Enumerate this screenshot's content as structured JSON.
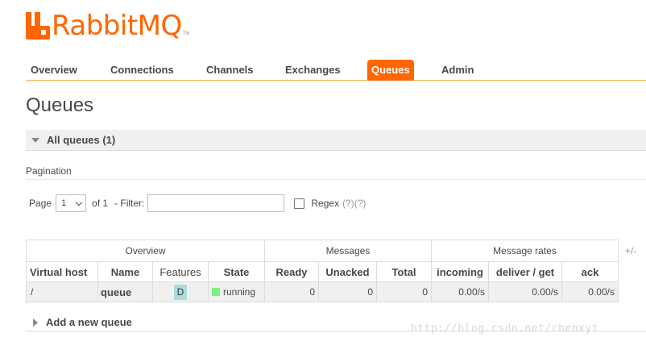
{
  "brand": {
    "name": "RabbitMQ",
    "tm": "TM",
    "color": "#ff6600"
  },
  "nav": {
    "items": [
      {
        "label": "Overview"
      },
      {
        "label": "Connections"
      },
      {
        "label": "Channels"
      },
      {
        "label": "Exchanges"
      },
      {
        "label": "Queues",
        "active": true
      },
      {
        "label": "Admin"
      }
    ]
  },
  "page": {
    "title": "Queues"
  },
  "section": {
    "label": "All queues (1)"
  },
  "pagination": {
    "label": "Pagination",
    "page_label": "Page",
    "page_value": "1",
    "of_label": "of 1",
    "filter_label": "- Filter:",
    "filter_value": "",
    "regex_label": "Regex",
    "help": "(?)(?)"
  },
  "table": {
    "groups": {
      "overview": "Overview",
      "messages": "Messages",
      "rates": "Message rates"
    },
    "columns": {
      "vhost": "Virtual host",
      "name": "Name",
      "features": "Features",
      "state": "State",
      "ready": "Ready",
      "unacked": "Unacked",
      "total": "Total",
      "incoming": "incoming",
      "deliver": "deliver / get",
      "ack": "ack"
    },
    "rows": [
      {
        "vhost": "/",
        "name": "queue",
        "features": "D",
        "state": "running",
        "ready": "0",
        "unacked": "0",
        "total": "0",
        "incoming": "0.00/s",
        "deliver": "0.00/s",
        "ack": "0.00/s"
      }
    ],
    "toggle": "+/-"
  },
  "add_queue": {
    "label": "Add a new queue"
  },
  "watermark": "http://blog.csdn.net/chenxyt"
}
